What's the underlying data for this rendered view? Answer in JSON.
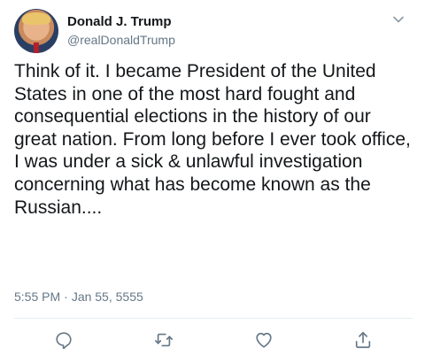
{
  "tweet": {
    "author_name": "Donald J. Trump",
    "author_handle": "@realDonaldTrump",
    "text": "Think of it. I became President of the United States in one of the most hard fought and consequential elections in the history of our great nation. From long before I ever took office, I was under a sick & unlawful investigation concerning what has become known as the Russian....",
    "time": "5:55 PM",
    "separator": "·",
    "date": "Jan 55, 5555"
  },
  "icons": {
    "menu": "chevron-down-icon",
    "reply": "reply-icon",
    "retweet": "retweet-icon",
    "like": "heart-icon",
    "share": "share-icon"
  },
  "colors": {
    "text": "#14171a",
    "muted": "#657786",
    "divider": "#e6ecf0"
  }
}
